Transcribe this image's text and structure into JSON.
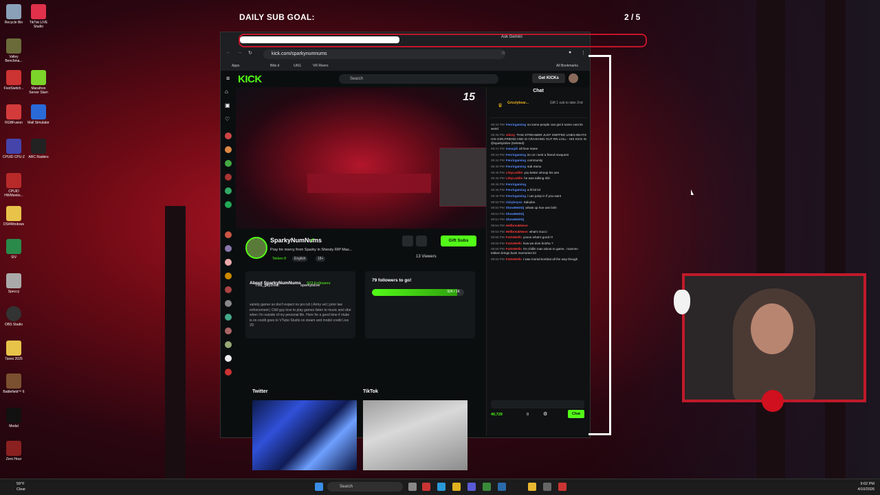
{
  "overlay": {
    "sub_goal_label": "DAILY SUB GOAL:",
    "sub_goal_count": "2 / 5"
  },
  "desktop_icons": [
    "Recycle Bin",
    "TikTok LIVE Studio",
    "Valley Benchma...",
    "FootSwitch...",
    "Marathon Server Slam",
    "RGBFusion",
    "Mall Simulator",
    "CPUID CPU-Z",
    "ARC Raiders",
    "CPUID HWMonito...",
    "DS4Windows",
    "SIV",
    "Speccy",
    "OBS Studio",
    "Taxes 2025",
    "Battlefield™ 6",
    "Medal",
    "Zero Hour"
  ],
  "browser": {
    "ask_gemini": "Ask Gemini",
    "url": "kick.com/sparkynumnums",
    "bookmarks": [
      "Apps",
      "Bills d",
      "UKG",
      "VR Rivers"
    ],
    "all_bookmarks": "All Bookmarks"
  },
  "kick": {
    "logo": "KICK",
    "search_placeholder": "Search",
    "get_kicks": "Get KICKs",
    "video_number": "15",
    "streamer": {
      "name": "SparkyNumNums",
      "title": "Pray for mercy from Sparky in Shiesty RIP Mas...",
      "category": "Tekken 8",
      "language": "English",
      "rating": "18+",
      "gift_subs": "Gift Subs",
      "viewers": "13 Viewers"
    },
    "about": {
      "title": "About SparkyNumNums",
      "followers": "923 Followers",
      "socials": [
        "This_guy2real",
        "sparkyislive"
      ],
      "bio": "variety gamer so don't expect no pro ish | Army vet | prior law enforcement | Chill guy love to play games listen to music and vibe when I'm outside of my personal life. Here for a good time if vtube is on credit goes to VTube Studio on steam and model credit Live 2D"
    },
    "goal": {
      "title": "79 followers to go!",
      "progress_text": "924 / 1K",
      "progress": 0.924
    },
    "panels": [
      "Twitter",
      "TikTok"
    ]
  },
  "chat": {
    "header": "Chat",
    "pinned_user": "Grizzlybear...",
    "pinned_note": "Gift 1 sub to take 2nd",
    "messages": [
      {
        "time": "08:34 PM",
        "user": "Fenrirgaming",
        "color": "#5a8cff",
        "text": "so some people can get it some cant its weird"
      },
      {
        "time": "08:35 PM",
        "user": "zrkzzy",
        "color": "#ff3b3b",
        "text": "THIS STREAMER JUST SNIFFED LINES BEATS HIS GIRLFRIEND AND IS CRASHING OUT RN LOLL - HIS KICK IS @sparkyislive (Deleted)"
      },
      {
        "time": "08:41 PM",
        "user": "meaujdi",
        "color": "#5a8cff",
        "text": "all love mane"
      },
      {
        "time": "08:43 PM",
        "user": "Fenrirgaming",
        "color": "#5a8cff",
        "text": "im on i sent a friend rewquest"
      },
      {
        "time": "08:44 PM",
        "user": "Fenrirgaming",
        "color": "#5a8cff",
        "text": "community"
      },
      {
        "time": "08:45 PM",
        "user": "Fenrirgaming",
        "color": "#5a8cff",
        "text": "sub menu"
      },
      {
        "time": "08:45 PM",
        "user": "LittyLaddle",
        "color": "#ff3b3b",
        "text": "you better whoop his ass"
      },
      {
        "time": "08:46 PM",
        "user": "LittyLaddle",
        "color": "#ff3b3b",
        "text": "he was talking shit"
      },
      {
        "time": "08:46 PM",
        "user": "Fenrirgaming",
        "color": "#5a8cff",
        "text": ""
      },
      {
        "time": "08:46 PM",
        "user": "Fenrirgaming",
        "color": "#5a8cff",
        "text": "a lil bit lol"
      },
      {
        "time": "08:48 PM",
        "user": "Fenrirgaming",
        "color": "#5a8cff",
        "text": "i can jump in if you want"
      },
      {
        "time": "08:50 PM",
        "user": "rickyboyss",
        "color": "#5a8cff",
        "text": "Saludos"
      },
      {
        "time": "08:50 PM",
        "user": "ShowMeDDj",
        "color": "#5a8cff",
        "text": "whats up hoe ass bish"
      },
      {
        "time": "08:51 PM",
        "user": "ShowMeDDj",
        "color": "#5a8cff",
        "text": ""
      },
      {
        "time": "08:51 PM",
        "user": "ShowMeDDj",
        "color": "#5a8cff",
        "text": ""
      },
      {
        "time": "08:54 PM",
        "user": "HellbreakNeon",
        "color": "#ff3b3b",
        "text": ""
      },
      {
        "time": "08:54 PM",
        "user": "HellbreakNeon",
        "color": "#ff3b3b",
        "text": "what's Gucci"
      },
      {
        "time": "08:55 PM",
        "user": "FuttsWells",
        "color": "#ff3b3b",
        "text": "yoooo what's good !!!"
      },
      {
        "time": "08:56 PM",
        "user": "FuttsWells",
        "color": "#ff3b3b",
        "text": "how we doin brotha ?"
      },
      {
        "time": "08:56 PM",
        "user": "FuttsWells",
        "color": "#ff3b3b",
        "text": "I'm chillin man about to game.. mannnn tekken brings back memories lol"
      },
      {
        "time": "08:58 PM",
        "user": "FuttsWells",
        "color": "#ff3b3b",
        "text": "I was mortal kombat all the way though"
      }
    ],
    "points": "40,729",
    "gift_count": "0",
    "send_label": "Chat"
  },
  "taskbar": {
    "weather_temp": "59°F",
    "weather_desc": "Clear",
    "search_placeholder": "Search",
    "time": "9:02 PM",
    "date": "4/10/2026"
  }
}
